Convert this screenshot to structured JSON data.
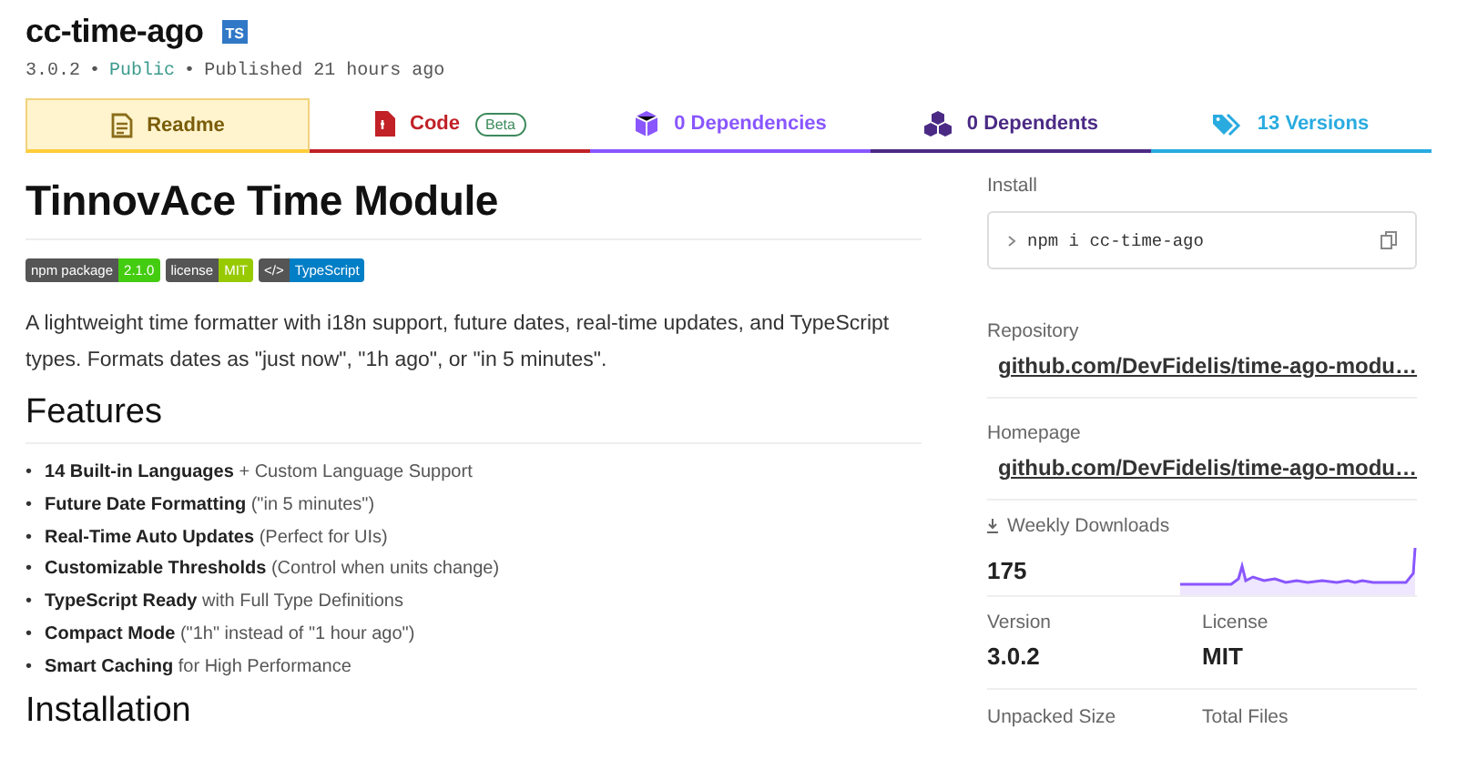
{
  "package": {
    "name": "cc-time-ago",
    "types_badge": "TS",
    "version": "3.0.2",
    "visibility": "Public",
    "published": "Published 21 hours ago",
    "separator": "•"
  },
  "tabs": [
    {
      "label": "Readme",
      "kind": "readme",
      "color": "#ffcd3a",
      "selected": true
    },
    {
      "label": "Code",
      "kind": "code",
      "color": "#c12127",
      "badge": "Beta",
      "selected": false
    },
    {
      "label": "0 Dependencies",
      "kind": "dependencies",
      "color": "#8956ff",
      "selected": false
    },
    {
      "label": "0 Dependents",
      "kind": "dependents",
      "color": "#4b2a85",
      "selected": false
    },
    {
      "label": "13 Versions",
      "kind": "versions",
      "color": "#29abe0",
      "selected": false
    }
  ],
  "readme": {
    "title": "TinnovAce Time Module",
    "badges": [
      {
        "label": "npm package",
        "value": "2.1.0",
        "color": "#4c1"
      },
      {
        "label": "license",
        "value": "MIT",
        "color": "#97ca00"
      },
      {
        "label": "</>",
        "value": "TypeScript",
        "color": "#007ec6"
      }
    ],
    "description": "A lightweight time formatter with i18n support, future dates, real-time updates, and TypeScript types. Formats dates as \"just now\", \"1h ago\", or \"in 5 minutes\".",
    "features_heading": "Features",
    "bullet": "•",
    "features": [
      "**14 Built-in Languages** + Custom Language Support",
      "**Future Date Formatting** (\"in 5 minutes\")",
      "**Real-Time Auto Updates** (Perfect for UIs)",
      "**Customizable Thresholds** (Control when units change)",
      "**TypeScript Ready** with Full Type Definitions",
      "**Compact Mode** (\"1h\" instead of \"1 hour ago\")",
      "**Smart Caching** for High Performance"
    ],
    "installation_heading": "Installation"
  },
  "sidebar": {
    "install_label": "Install",
    "install_command": "npm i cc-time-ago",
    "repository_label": "Repository",
    "repository_link": "github.com/DevFidelis/time-ago-modu…",
    "homepage_label": "Homepage",
    "homepage_link": "github.com/DevFidelis/time-ago-modu…",
    "downloads_label": "Weekly Downloads",
    "downloads": "175",
    "version_label": "Version",
    "version": "3.0.2",
    "license_label": "License",
    "license": "MIT",
    "unpacked_size_label": "Unpacked Size",
    "total_files_label": "Total Files"
  }
}
